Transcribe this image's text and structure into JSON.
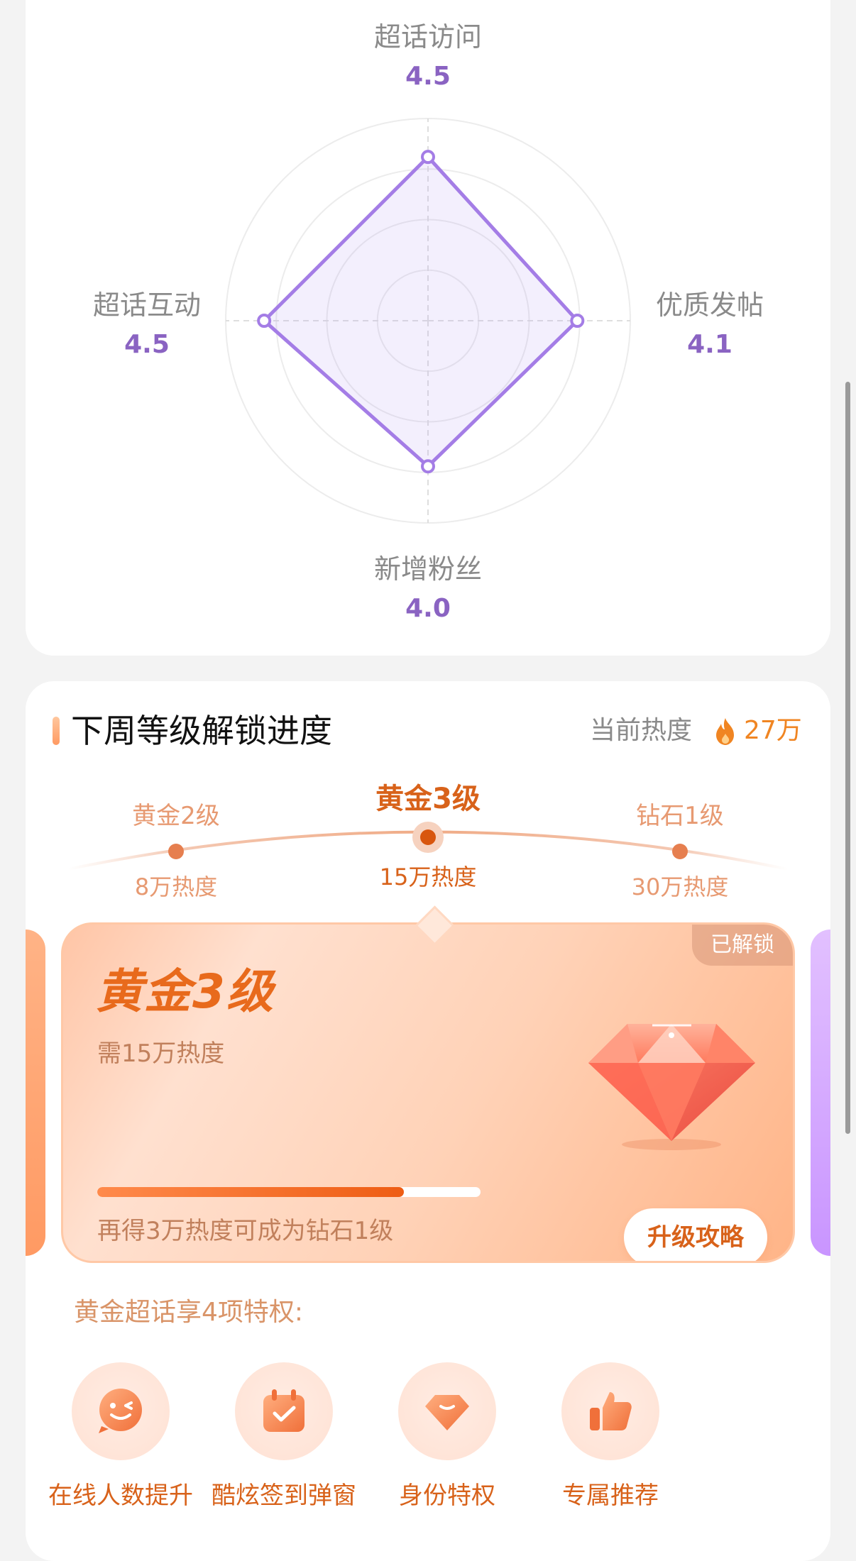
{
  "radar": {
    "axes": [
      {
        "label": "超话访问",
        "value": "4.5"
      },
      {
        "label": "优质发帖",
        "value": "4.1"
      },
      {
        "label": "新增粉丝",
        "value": "4.0"
      },
      {
        "label": "超话互动",
        "value": "4.5"
      }
    ],
    "color": "#a47de6"
  },
  "chart_data": {
    "type": "radar",
    "categories": [
      "超话访问",
      "优质发帖",
      "新增粉丝",
      "超话互动"
    ],
    "values": [
      4.5,
      4.1,
      4.0,
      4.5
    ]
  },
  "level_section": {
    "title": "下周等级解锁进度",
    "heat_label": "当前热度",
    "heat_icon": "flame-icon",
    "heat_value": "27万",
    "levels": [
      {
        "name": "黄金2级",
        "requirement": "8万热度"
      },
      {
        "name": "黄金3级",
        "requirement": "15万热度"
      },
      {
        "name": "钻石1级",
        "requirement": "30万热度"
      }
    ],
    "current_index": 1,
    "panel": {
      "badge": "已解锁",
      "title": "黄金3级",
      "subtitle": "需15万热度",
      "progress_fraction": 0.8,
      "hint": "再得3万热度可成为钻石1级",
      "button": "升级攻略",
      "gem_icon": "diamond-icon"
    },
    "perks_title": "黄金超话享4项特权:",
    "perks": [
      {
        "label": "在线人数提升",
        "icon": "wink-face-icon"
      },
      {
        "label": "酷炫签到弹窗",
        "icon": "calendar-check-icon"
      },
      {
        "label": "身份特权",
        "icon": "diamond-badge-icon"
      },
      {
        "label": "专属推荐",
        "icon": "thumbs-up-icon"
      }
    ],
    "accent": "#d8621a"
  }
}
